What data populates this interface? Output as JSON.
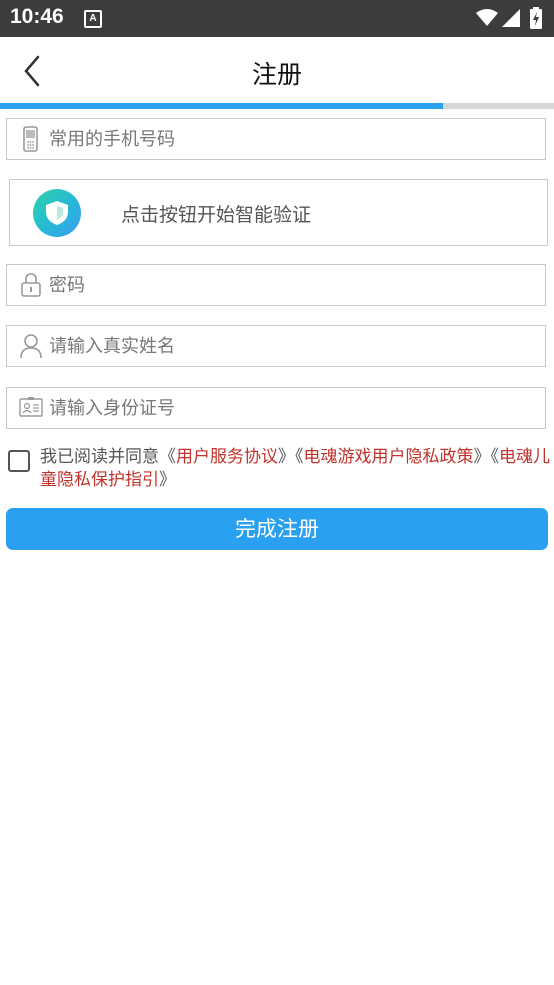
{
  "status_bar": {
    "time": "10:46",
    "notification_icon": "app-notification-icon",
    "icons": [
      "wifi-icon",
      "signal-icon",
      "battery-charging-icon"
    ]
  },
  "header": {
    "title": "注册",
    "back_icon": "chevron-left-icon"
  },
  "progress": {
    "value": 0.8,
    "color": "#2aa0f0"
  },
  "form": {
    "phone": {
      "placeholder": "常用的手机号码",
      "value": "",
      "icon": "phone-icon"
    },
    "verify": {
      "label": "点击按钮开始智能验证",
      "icon": "shield-icon"
    },
    "password": {
      "placeholder": "密码",
      "value": "",
      "icon": "lock-icon"
    },
    "real_name": {
      "placeholder": "请输入真实姓名",
      "value": "",
      "icon": "person-icon"
    },
    "id_number": {
      "placeholder": "请输入身份证号",
      "value": "",
      "icon": "id-card-icon"
    }
  },
  "agreement": {
    "prefix": "我已阅读并同意《",
    "link1": "用户服务协议",
    "mid1": "》《",
    "link2": "电魂游戏用户隐私政策",
    "mid2": "》《",
    "link3": "电魂儿童隐私保护指引",
    "suffix": "》",
    "checked": false
  },
  "submit_label": "完成注册",
  "colors": {
    "accent": "#2aa0f0",
    "link": "#c0322b",
    "status_bar": "#3c3c3c"
  }
}
